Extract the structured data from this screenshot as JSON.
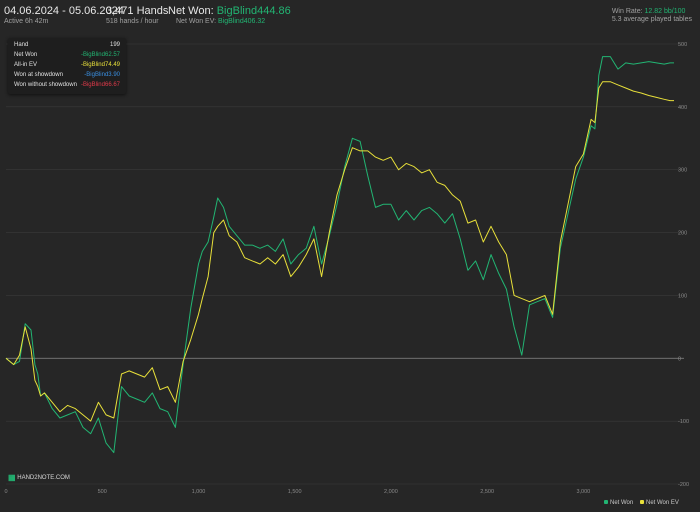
{
  "header": {
    "date_range": "04.06.2024 - 05.06.2024",
    "active": "Active 6h 42m",
    "hands": "3,471 Hands",
    "hands_rate": "518 hands / hour",
    "net_won_label": "Net Won:",
    "net_won_value": "BigBlind444.86",
    "net_won_ev_label": "Net Won EV:",
    "net_won_ev_value": "BigBlind406.32",
    "win_rate_label": "Win Rate:",
    "win_rate_value": "12.82 bb/100",
    "tables": "5.3 average played tables"
  },
  "tooltip": {
    "rows": [
      {
        "label": "Hand",
        "value": "199",
        "color": "#e0e0e0"
      },
      {
        "label": "Net Won",
        "value": "-BigBlind62.57",
        "color": "#22b573"
      },
      {
        "label": "All-in EV",
        "value": "-BigBlind74.49",
        "color": "#e8e03a"
      },
      {
        "label": "Won at showdown",
        "value": "-BigBlind3.90",
        "color": "#3a8fe0"
      },
      {
        "label": "Won without showdown",
        "value": "-BigBlind66.67",
        "color": "#e03a4a"
      }
    ]
  },
  "logo": {
    "text": "HAND2NOTE.COM"
  },
  "colors": {
    "net_won": "#22b573",
    "net_won_ev": "#e8e03a",
    "grid": "#3a3a3a",
    "zero": "#8a8a8a"
  },
  "chart_data": {
    "type": "line",
    "x_ticks": [
      "0",
      "500",
      "1,000",
      "1,500",
      "2,000",
      "2,500",
      "3,000"
    ],
    "y_ticks": [
      "-200",
      "-100",
      "0",
      "100",
      "200",
      "300",
      "400",
      "500"
    ],
    "xlim": [
      0,
      3471
    ],
    "ylim": [
      -200,
      500
    ],
    "grid": true,
    "legend_position": "bottom-right",
    "series": [
      {
        "name": "Net Won",
        "color": "#22b573",
        "x": [
          0,
          40,
          70,
          100,
          130,
          150,
          165,
          180,
          200,
          240,
          280,
          320,
          360,
          400,
          440,
          480,
          520,
          560,
          600,
          640,
          680,
          720,
          760,
          800,
          840,
          880,
          920,
          960,
          1000,
          1020,
          1050,
          1080,
          1100,
          1130,
          1160,
          1200,
          1240,
          1280,
          1320,
          1360,
          1400,
          1440,
          1480,
          1520,
          1560,
          1600,
          1640,
          1680,
          1720,
          1760,
          1800,
          1840,
          1880,
          1920,
          1960,
          2000,
          2040,
          2080,
          2120,
          2160,
          2200,
          2240,
          2280,
          2320,
          2360,
          2400,
          2440,
          2480,
          2520,
          2560,
          2600,
          2640,
          2680,
          2720,
          2760,
          2800,
          2840,
          2880,
          2920,
          2960,
          3000,
          3040,
          3060,
          3080,
          3100,
          3140,
          3180,
          3220,
          3260,
          3300,
          3340,
          3380,
          3420,
          3450,
          3471
        ],
        "values": [
          0,
          -10,
          -5,
          55,
          45,
          -10,
          -25,
          -60,
          -55,
          -80,
          -95,
          -90,
          -85,
          -110,
          -120,
          -95,
          -135,
          -150,
          -45,
          -60,
          -65,
          -70,
          -55,
          -80,
          -85,
          -110,
          -10,
          80,
          150,
          170,
          185,
          225,
          255,
          240,
          210,
          195,
          180,
          180,
          175,
          180,
          170,
          190,
          150,
          165,
          175,
          210,
          150,
          195,
          245,
          305,
          350,
          345,
          290,
          240,
          245,
          245,
          220,
          235,
          220,
          235,
          240,
          230,
          215,
          230,
          190,
          140,
          155,
          125,
          165,
          135,
          110,
          50,
          5,
          85,
          90,
          95,
          65,
          175,
          230,
          285,
          320,
          370,
          365,
          450,
          480,
          480,
          460,
          470,
          468,
          470,
          472,
          470,
          468,
          470,
          470
        ]
      },
      {
        "name": "Net Won EV",
        "color": "#e8e03a",
        "x": [
          0,
          40,
          70,
          100,
          130,
          150,
          165,
          180,
          200,
          240,
          280,
          320,
          360,
          400,
          440,
          480,
          520,
          560,
          600,
          640,
          680,
          720,
          760,
          800,
          840,
          880,
          920,
          960,
          1000,
          1020,
          1050,
          1080,
          1100,
          1130,
          1160,
          1200,
          1240,
          1280,
          1320,
          1360,
          1400,
          1440,
          1480,
          1520,
          1560,
          1600,
          1640,
          1680,
          1720,
          1760,
          1800,
          1840,
          1880,
          1920,
          1960,
          2000,
          2040,
          2080,
          2120,
          2160,
          2200,
          2240,
          2280,
          2320,
          2360,
          2400,
          2440,
          2480,
          2520,
          2560,
          2600,
          2640,
          2680,
          2720,
          2760,
          2800,
          2840,
          2880,
          2920,
          2960,
          3000,
          3040,
          3060,
          3080,
          3100,
          3140,
          3180,
          3220,
          3260,
          3300,
          3340,
          3380,
          3420,
          3450,
          3471
        ],
        "values": [
          0,
          -10,
          5,
          50,
          15,
          -35,
          -45,
          -60,
          -55,
          -70,
          -85,
          -75,
          -80,
          -90,
          -100,
          -70,
          -90,
          -95,
          -25,
          -20,
          -25,
          -30,
          -15,
          -50,
          -45,
          -70,
          -5,
          30,
          70,
          95,
          130,
          200,
          210,
          220,
          195,
          185,
          160,
          155,
          150,
          160,
          150,
          165,
          130,
          145,
          165,
          190,
          130,
          200,
          260,
          300,
          335,
          330,
          330,
          320,
          315,
          320,
          300,
          310,
          305,
          295,
          300,
          280,
          275,
          260,
          250,
          215,
          220,
          185,
          210,
          185,
          165,
          100,
          95,
          90,
          95,
          100,
          70,
          185,
          245,
          305,
          325,
          380,
          375,
          430,
          440,
          440,
          435,
          430,
          425,
          422,
          418,
          415,
          412,
          410,
          410
        ]
      }
    ]
  }
}
